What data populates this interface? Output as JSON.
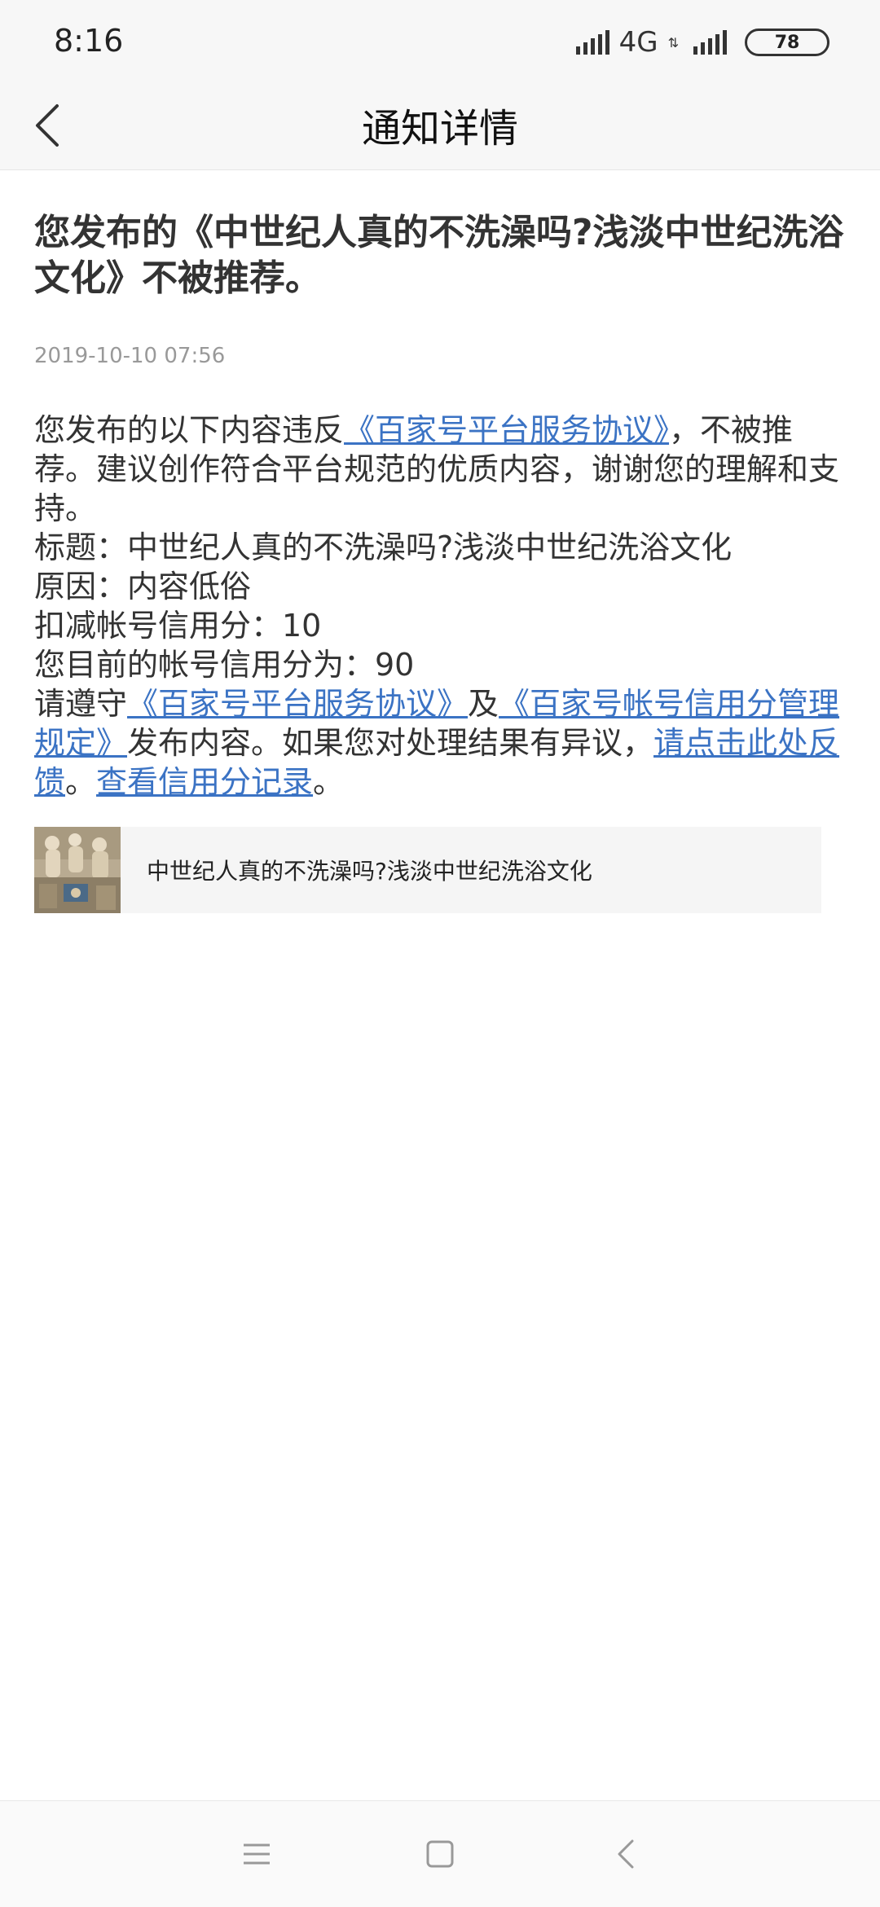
{
  "status_bar": {
    "time": "8:16",
    "network": "4G",
    "network_arrows": "⇅",
    "battery": "78"
  },
  "header": {
    "title": "通知详情"
  },
  "notice": {
    "headline": "您发布的《中世纪人真的不洗澡吗?浅淡中世纪洗浴文化》不被推荐。",
    "timestamp": "2019-10-10 07:56",
    "p1_prefix": "您发布的以下内容违反",
    "p1_link": "《百家号平台服务协议》",
    "p1_suffix": "，不被推荐。建议创作符合平台规范的优质内容，谢谢您的理解和支持。",
    "title_line": "标题：中世纪人真的不洗澡吗?浅淡中世纪洗浴文化",
    "reason_line": "原因：内容低俗",
    "deduct_line": "扣减帐号信用分：10",
    "score_line": "您目前的帐号信用分为：90",
    "p2_prefix": "请遵守",
    "p2_link1": "《百家号平台服务协议》",
    "p2_mid": "及",
    "p2_link2": "《百家号帐号信用分管理规定》",
    "p2_text": "发布内容。如果您对处理结果有异议，",
    "p2_link3": "请点击此处反馈",
    "p2_sep": "。",
    "p2_link4": "查看信用分记录",
    "p2_end": "。"
  },
  "article_card": {
    "title": "中世纪人真的不洗澡吗?浅淡中世纪洗浴文化"
  },
  "colors": {
    "link": "#3b73c4",
    "timestamp": "#999999",
    "card_bg": "#f5f5f5"
  },
  "icons": {
    "back": "chevron-left-icon",
    "menu": "menu-icon",
    "home": "square-icon",
    "nav_back": "chevron-left-icon"
  }
}
